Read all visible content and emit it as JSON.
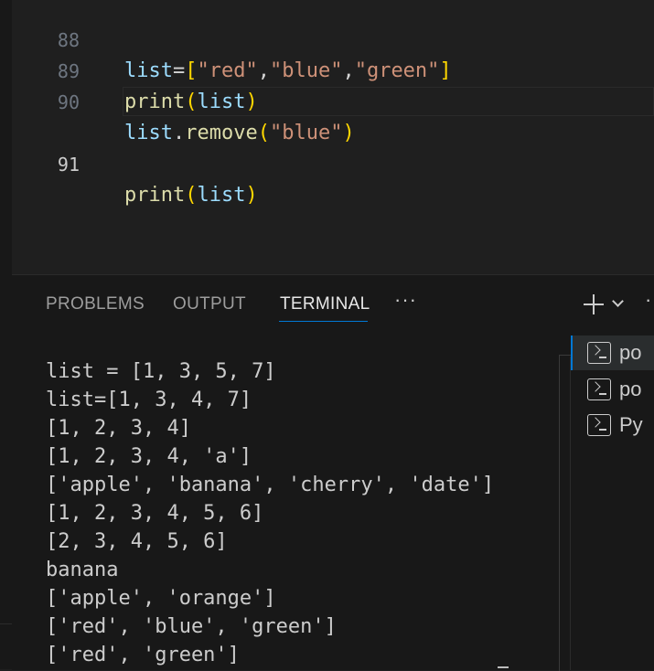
{
  "editor": {
    "lines": [
      {
        "number": "88",
        "tokens": [
          {
            "t": "list",
            "k": "var"
          },
          {
            "t": "=",
            "k": "punct"
          },
          {
            "t": "[",
            "k": "b1"
          },
          {
            "t": "\"red\"",
            "k": "str"
          },
          {
            "t": ",",
            "k": "punct"
          },
          {
            "t": "\"blue\"",
            "k": "str"
          },
          {
            "t": ",",
            "k": "punct"
          },
          {
            "t": "\"green\"",
            "k": "str"
          },
          {
            "t": "]",
            "k": "b1"
          }
        ]
      },
      {
        "number": "89",
        "tokens": [
          {
            "t": "print",
            "k": "fn"
          },
          {
            "t": "(",
            "k": "b1"
          },
          {
            "t": "list",
            "k": "var"
          },
          {
            "t": ")",
            "k": "b1"
          }
        ]
      },
      {
        "number": "90",
        "tokens": [
          {
            "t": "list",
            "k": "var"
          },
          {
            "t": ".",
            "k": "punct"
          },
          {
            "t": "remove",
            "k": "fn"
          },
          {
            "t": "(",
            "k": "b1"
          },
          {
            "t": "\"blue\"",
            "k": "str"
          },
          {
            "t": ")",
            "k": "b1"
          }
        ]
      },
      {
        "number": "91",
        "current": true,
        "tokens": [
          {
            "t": "print",
            "k": "fn"
          },
          {
            "t": "(",
            "k": "b1"
          },
          {
            "t": "list",
            "k": "var"
          },
          {
            "t": ")",
            "k": "b1"
          }
        ]
      }
    ]
  },
  "panel": {
    "tabs": {
      "problems": "PROBLEMS",
      "output": "OUTPUT",
      "terminal": "TERMINAL",
      "more": "···"
    },
    "actions": {
      "more_actions": "·"
    },
    "terminal_output": [
      "list = [1, 3, 5, 7]",
      "list=[1, 3, 4, 7]",
      "[1, 2, 3, 4]",
      "[1, 2, 3, 4, 'a']",
      "['apple', 'banana', 'cherry', 'date']",
      "[1, 2, 3, 4, 5, 6]",
      "[2, 3, 4, 5, 6]",
      "banana",
      "['apple', 'orange']",
      "['red', 'blue', 'green']",
      "['red', 'green']"
    ],
    "terminal_list": [
      {
        "label": "po",
        "icon": "terminal-powershell-icon",
        "active": true
      },
      {
        "label": "po",
        "icon": "terminal-powershell-icon",
        "active": false
      },
      {
        "label": "Py",
        "icon": "terminal-python-icon",
        "active": false
      }
    ]
  },
  "colors": {
    "accent": "#0078d4",
    "background": "#1f1f1f",
    "panel_background": "#181818"
  }
}
